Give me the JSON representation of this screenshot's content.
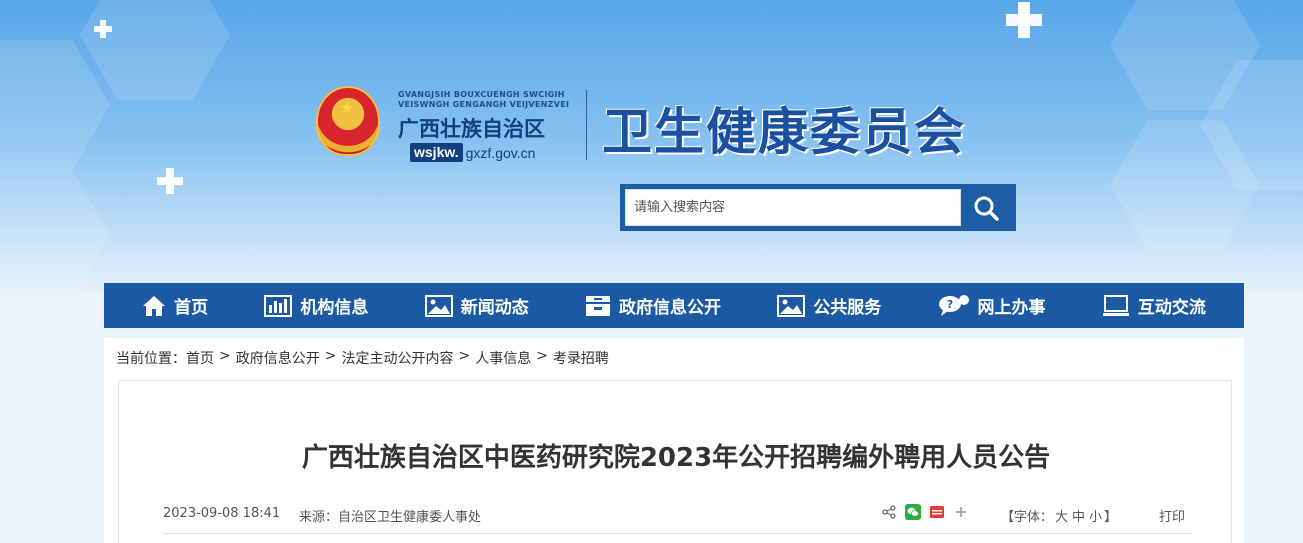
{
  "header": {
    "logo_en_line1": "GVANGJSIH BOUXCUENGH SWCIGIH",
    "logo_en_line2": "VEISWNGH GENGANGH VEIJVENZVEI",
    "logo_cn": "广西壮族自治区",
    "domain_box": "wsjkw.",
    "domain_rest": "gxzf.gov.cn",
    "site_title": "卫生健康委员会"
  },
  "search": {
    "placeholder": "请输入搜索内容",
    "button_icon": "search-icon"
  },
  "nav": {
    "items": [
      {
        "label": "首页",
        "icon": "home-icon"
      },
      {
        "label": "机构信息",
        "icon": "bar-chart-icon"
      },
      {
        "label": "新闻动态",
        "icon": "picture-icon"
      },
      {
        "label": "政府信息公开",
        "icon": "cabinet-icon"
      },
      {
        "label": "公共服务",
        "icon": "picture-icon"
      },
      {
        "label": "网上办事",
        "icon": "chat-icon"
      },
      {
        "label": "互动交流",
        "icon": "monitor-icon"
      }
    ]
  },
  "breadcrumb": {
    "prefix": "当前位置：",
    "items": [
      "首页",
      "政府信息公开",
      "法定主动公开内容",
      "人事信息",
      "考录招聘"
    ],
    "separator": ">"
  },
  "article": {
    "title": "广西壮族自治区中医药研究院2023年公开招聘编外聘用人员公告",
    "date": "2023-09-08 18:41",
    "source": "来源：自治区卫生健康委人事处",
    "font_size_label_open": "【字体：",
    "font_size_options": [
      "大",
      "中",
      "小"
    ],
    "font_size_label_close": "】",
    "print_label": "打印",
    "share_icons": [
      "share-icon",
      "wechat-icon",
      "toutiao-icon",
      "plus-icon"
    ]
  },
  "colors": {
    "nav_bg": "#1b5aa3",
    "title_blue": "#1b4fa0",
    "wechat_green": "#2aae3f",
    "toutiao_red": "#e23a2e"
  }
}
